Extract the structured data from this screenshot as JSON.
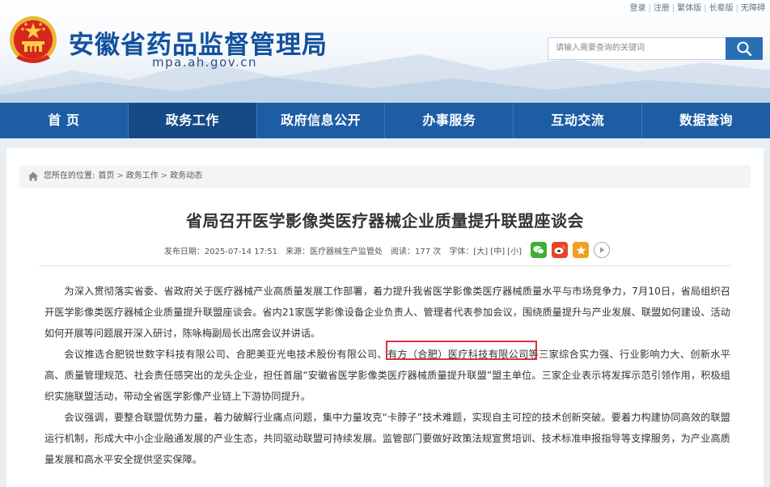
{
  "header": {
    "top_links": [
      "登录",
      "注册",
      "繁体版",
      "长辈版",
      "无障碍"
    ],
    "site_title": "安徽省药品监督管理局",
    "site_domain": "mpa.ah.gov.cn",
    "search": {
      "placeholder": "请输入需要查询的关键词"
    }
  },
  "nav": {
    "items": [
      "首 页",
      "政务工作",
      "政府信息公开",
      "办事服务",
      "互动交流",
      "数据查询"
    ],
    "active": "政务工作"
  },
  "breadcrumb": {
    "prefix": "您所在的位置:",
    "items": [
      "首页",
      "政务工作",
      "政务动态"
    ],
    "separator": ">"
  },
  "article": {
    "title": "省局召开医学影像类医疗器械企业质量提升联盟座谈会",
    "meta": {
      "date": "发布日期：2025-07-14 17:51",
      "source": "来源：医疗器械生产监管处",
      "views": "阅读：177 次",
      "font_label": "字体：[大] [中] [小]"
    },
    "paragraphs": [
      "为深入贯彻落实省委、省政府关于医疗器械产业高质量发展工作部署，着力提升我省医学影像类医疗器械质量水平与市场竞争力，7月10日，省局组织召开医学影像类医疗器械企业质量提升联盟座谈会。省内21家医学影像设备企业负责人、管理者代表参加会议，围绕质量提升与产业发展、联盟如何建设、活动如何开展等问题展开深入研讨，陈咏梅副局长出席会议并讲话。",
      "会议推选合肥锐世数字科技有限公司、合肥美亚光电技术股份有限公司、有方（合肥）医疗科技有限公司等三家综合实力强、行业影响力大、创新水平高、质量管理规范、社会责任感突出的龙头企业，担任首届“安徽省医学影像类医疗器械质量提升联盟”盟主单位。三家企业表示将发挥示范引领作用，积极组织实施联盟活动，带动全省医学影像产业链上下游协同提升。",
      "会议强调，要整合联盟优势力量，着力破解行业痛点问题，集中力量攻克“卡脖子”技术难题，实现自主可控的技术创新突破。要着力构建协同高效的联盟运行机制，形成大中小企业融通发展的产业生态，共同驱动联盟可持续发展。监管部门要做好政策法规宣贯培训、技术标准申报指导等支撑服务，为产业高质量发展和高水平安全提供坚实保障。"
    ]
  },
  "share_icons": [
    "wechat-icon",
    "weibo-icon",
    "favorite-icon",
    "play-icon"
  ],
  "colors": {
    "brand_blue": "#1c5da5",
    "nav_active": "#154a86",
    "title_blue": "#12519e",
    "highlight_red": "#e0303a",
    "wechat_green": "#3cb034",
    "weibo_red": "#e6452b",
    "favorite_orange": "#f0a020"
  }
}
